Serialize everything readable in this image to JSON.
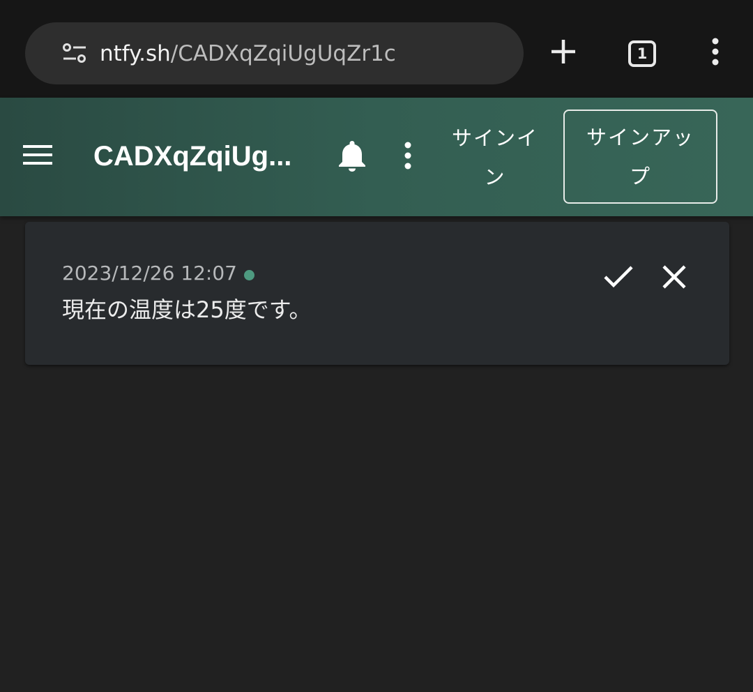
{
  "browser": {
    "url_host": "ntfy.sh",
    "url_path": "/CADXqZqiUgUqZr1c",
    "tab_count": "1",
    "icons": {
      "site_settings": "tune-icon",
      "new_tab": "plus-icon",
      "tabs": "tab-switcher-icon",
      "menu": "more-vert-icon"
    }
  },
  "app_bar": {
    "title": "CADXqZqiUg...",
    "signin_label": "サインイン",
    "signup_label": "サインアップ",
    "icons": {
      "menu": "hamburger-icon",
      "notifications": "bell-icon",
      "more": "more-vert-icon"
    }
  },
  "notifications": [
    {
      "time": "2023/12/26 12:07",
      "message": "現在の温度は25度です。",
      "status_color": "#4e9a80"
    }
  ],
  "colors": {
    "app_bar_start": "#2a4a42",
    "app_bar_end": "#386658",
    "background": "#212121",
    "card": "#282b2e",
    "unread_dot": "#4e9a80"
  }
}
